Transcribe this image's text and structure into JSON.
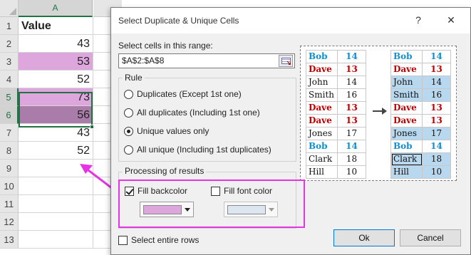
{
  "sheet": {
    "column_header": "A",
    "rows": [
      {
        "num": "1",
        "value": "Value",
        "style": "header"
      },
      {
        "num": "2",
        "value": "43",
        "style": ""
      },
      {
        "num": "3",
        "value": "53",
        "style": "pink"
      },
      {
        "num": "4",
        "value": "52",
        "style": ""
      },
      {
        "num": "5",
        "value": "73",
        "style": "pink"
      },
      {
        "num": "6",
        "value": "56",
        "style": "dark"
      },
      {
        "num": "7",
        "value": "43",
        "style": ""
      },
      {
        "num": "8",
        "value": "52",
        "style": ""
      },
      {
        "num": "9",
        "value": "",
        "style": ""
      },
      {
        "num": "10",
        "value": "",
        "style": ""
      },
      {
        "num": "11",
        "value": "",
        "style": ""
      },
      {
        "num": "12",
        "value": "",
        "style": ""
      },
      {
        "num": "13",
        "value": "",
        "style": ""
      }
    ]
  },
  "dialog": {
    "title": "Select Duplicate & Unique Cells",
    "help": "?",
    "close": "✕",
    "range_label": "Select cells in this range:",
    "range_value": "$A$2:$A$8",
    "rule_title": "Rule",
    "rules": [
      {
        "label": "Duplicates (Except 1st one)",
        "selected": false
      },
      {
        "label": "All duplicates (Including 1st one)",
        "selected": false
      },
      {
        "label": "Unique values only",
        "selected": true
      },
      {
        "label": "All unique (Including 1st duplicates)",
        "selected": false
      }
    ],
    "processing_title": "Processing of results",
    "fill_backcolor": {
      "label": "Fill backcolor",
      "checked": true,
      "color": "#dda6dd"
    },
    "fill_font_color": {
      "label": "Fill font color",
      "checked": false,
      "color": "#dce6f0"
    },
    "select_entire_rows": {
      "label": "Select entire rows",
      "checked": false
    },
    "ok": "Ok",
    "cancel": "Cancel"
  },
  "illustration": {
    "left": [
      {
        "name": "Bob",
        "val": "14",
        "color": "blue"
      },
      {
        "name": "Dave",
        "val": "13",
        "color": "red"
      },
      {
        "name": "John",
        "val": "14",
        "color": "black"
      },
      {
        "name": "Smith",
        "val": "16",
        "color": "black"
      },
      {
        "name": "Dave",
        "val": "13",
        "color": "red"
      },
      {
        "name": "Dave",
        "val": "13",
        "color": "red"
      },
      {
        "name": "Jones",
        "val": "17",
        "color": "black"
      },
      {
        "name": "Bob",
        "val": "14",
        "color": "blue"
      },
      {
        "name": "Clark",
        "val": "18",
        "color": "black"
      },
      {
        "name": "Hill",
        "val": "10",
        "color": "black"
      }
    ],
    "right": [
      {
        "name": "Bob",
        "val": "14",
        "color": "blue",
        "hl": false
      },
      {
        "name": "Dave",
        "val": "13",
        "color": "red",
        "hl": false
      },
      {
        "name": "John",
        "val": "14",
        "color": "black",
        "hl": true
      },
      {
        "name": "Smith",
        "val": "16",
        "color": "black",
        "hl": true
      },
      {
        "name": "Dave",
        "val": "13",
        "color": "red",
        "hl": false
      },
      {
        "name": "Dave",
        "val": "13",
        "color": "red",
        "hl": false
      },
      {
        "name": "Jones",
        "val": "17",
        "color": "black",
        "hl": true
      },
      {
        "name": "Bob",
        "val": "14",
        "color": "blue",
        "hl": false
      },
      {
        "name": "Clark",
        "val": "18",
        "color": "black",
        "hl": true
      },
      {
        "name": "Hill",
        "val": "10",
        "color": "black",
        "hl": true
      }
    ]
  },
  "colors": {
    "accent_green": "#217346",
    "highlight_magenta": "#e633e6",
    "fill_pink": "#dda6dd",
    "fill_dark": "#a97ca9",
    "illus_highlight": "#b8d8f0"
  }
}
